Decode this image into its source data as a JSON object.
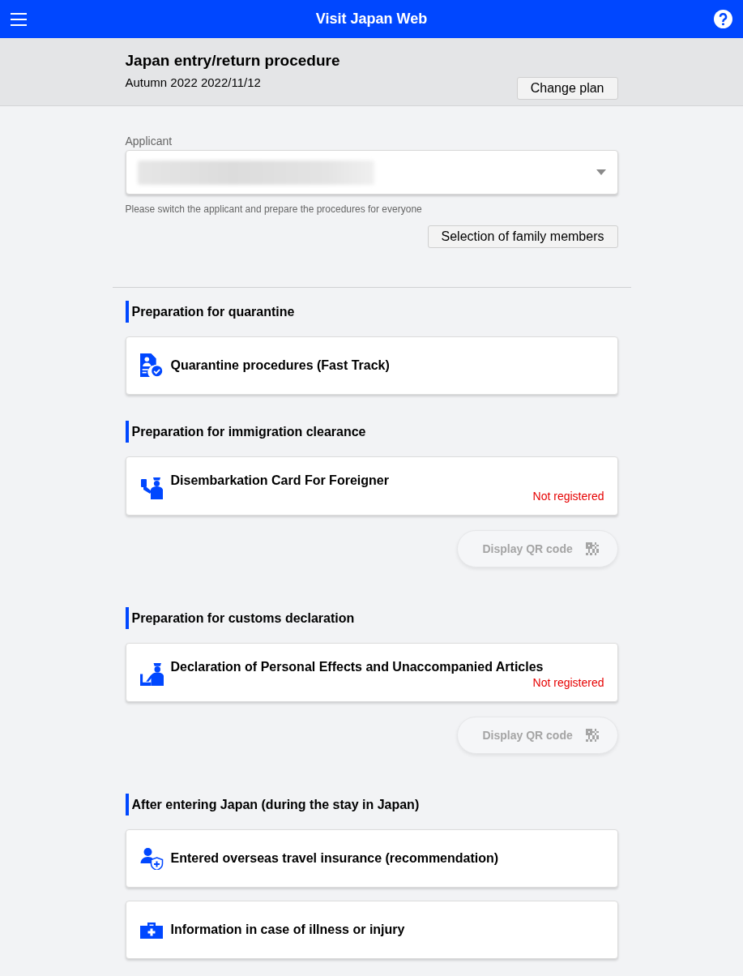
{
  "app_bar": {
    "title": "Visit Japan Web"
  },
  "plan": {
    "title": "Japan entry/return procedure",
    "subtitle": "Autumn 2022 2022/11/12",
    "button": "Change plan"
  },
  "applicant": {
    "label": "Applicant",
    "value_blurred": true,
    "hint": "Please switch the applicant and prepare the procedures for everyone",
    "button": "Selection of family members"
  },
  "sections": [
    {
      "title": "Preparation for quarantine",
      "items": [
        {
          "kind": "quarantine",
          "title": "Quarantine procedures (Fast Track)"
        }
      ]
    },
    {
      "title": "Preparation for immigration clearance",
      "items": [
        {
          "kind": "immigration",
          "title": "Disembarkation Card For Foreigner",
          "status": "Not registered"
        }
      ],
      "qr_button": {
        "label": "Display QR code",
        "disabled": true
      }
    },
    {
      "title": "Preparation for customs declaration",
      "items": [
        {
          "kind": "customs",
          "title": "Declaration of Personal Effects and Unaccompanied Articles",
          "status": "Not registered"
        }
      ],
      "qr_button": {
        "label": "Display QR code",
        "disabled": true
      }
    },
    {
      "title": "After entering Japan (during the stay in Japan)",
      "items": [
        {
          "kind": "insurance",
          "title": "Entered overseas travel insurance (recommendation)"
        },
        {
          "kind": "medical",
          "title": "Information in case of illness or injury"
        }
      ]
    }
  ]
}
